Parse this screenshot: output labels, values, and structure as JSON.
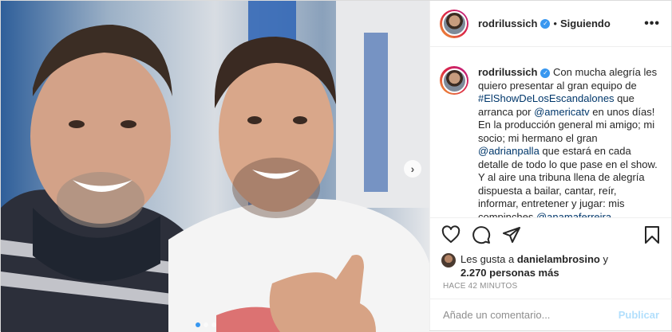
{
  "post": {
    "username": "rodrilussich",
    "verified_badge": "✓",
    "separator": "•",
    "follow_status": "Siguiendo",
    "more_label": "•••"
  },
  "caption": {
    "username": "rodrilussich",
    "parts": [
      "Con mucha alegría les quiero presentar al gran equipo de ",
      "#ElShowDeLosEscandalones",
      " que arranca por ",
      "@americatv",
      " en unos días! En la producción general mi amigo; mi socio; mi hermano el gran ",
      "@adrianpalla",
      " que estará en cada detalle de todo lo que pase en el show. Y al aire una tribuna llena de alegría dispuesta a bailar, cantar, reír, informar, entretener y jugar: mis compinches ",
      "@anamaferreira"
    ]
  },
  "actions": {
    "like_icon": "heart-icon",
    "comment_icon": "comment-icon",
    "share_icon": "share-icon",
    "save_icon": "bookmark-icon"
  },
  "likes": {
    "prefix": "Les gusta a ",
    "user": "danielambrosino",
    "middle": " y",
    "count": "2.270 personas más"
  },
  "timestamp": "HACE 42 MINUTOS",
  "comment": {
    "placeholder": "Añade un comentario...",
    "publish": "Publicar"
  },
  "media": {
    "next_label": "›",
    "carousel": {
      "count": 3,
      "active": 1
    }
  },
  "colors": {
    "link": "#00376b",
    "verified": "#3897f0",
    "publish_disabled": "#b2dffc",
    "muted": "#8e8e8e"
  }
}
